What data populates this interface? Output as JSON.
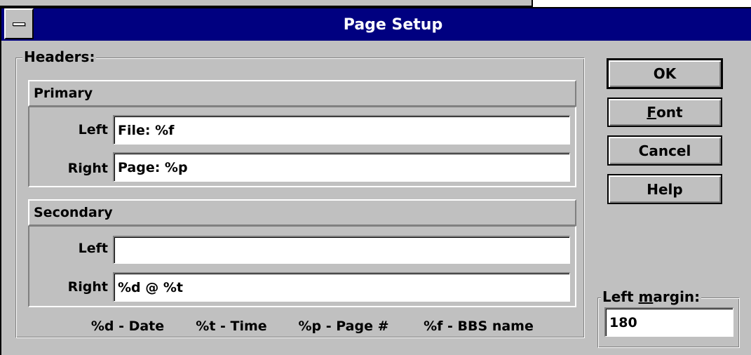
{
  "dialog": {
    "title": "Page Setup"
  },
  "headers": {
    "group_label": "Headers:",
    "primary": {
      "label": "Primary",
      "left_label": "Left",
      "left_value": "File: %f",
      "right_label": "Right",
      "right_value": "Page: %p"
    },
    "secondary": {
      "label": "Secondary",
      "left_label": "Left",
      "left_value": "",
      "right_label": "Right",
      "right_value": "%d @ %t"
    },
    "legend": [
      "%d - Date",
      "%t - Time",
      "%p - Page #",
      "%f - BBS name"
    ]
  },
  "buttons": {
    "ok": "OK",
    "font_mnemonic": "F",
    "font_rest": "ont",
    "cancel": "Cancel",
    "help": "Help"
  },
  "left_margin": {
    "label_prefix": "Left ",
    "label_mnemonic": "m",
    "label_rest": "argin:",
    "value": "180"
  }
}
